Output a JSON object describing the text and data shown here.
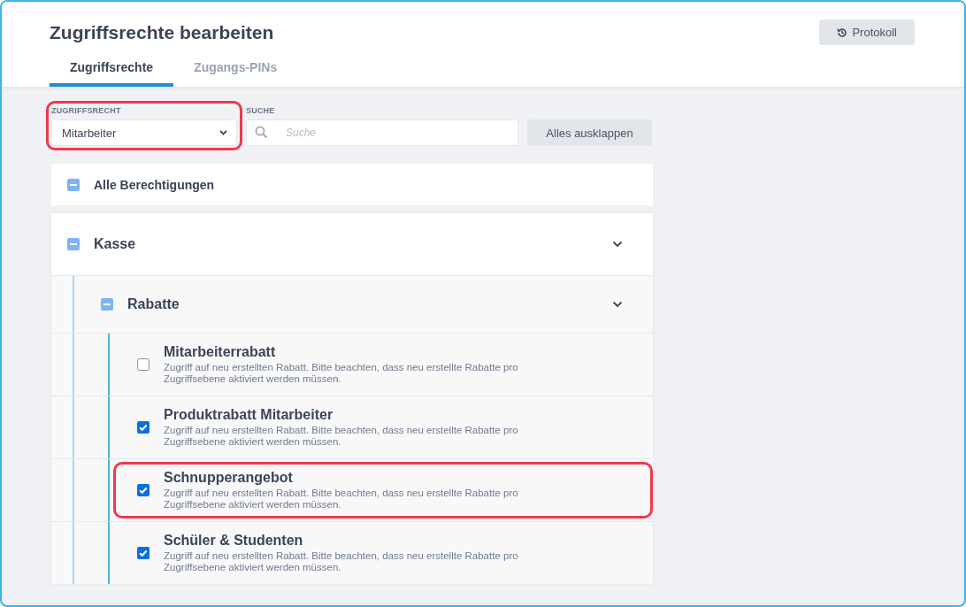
{
  "header": {
    "title": "Zugriffsrechte bearbeiten",
    "protocol_button": "Protokoll"
  },
  "tabs": [
    {
      "label": "Zugriffsrechte",
      "selected": true
    },
    {
      "label": "Zugangs-PINs",
      "selected": false
    }
  ],
  "filters": {
    "role": {
      "label": "ZUGRIFFSRECHT",
      "value": "Mitarbeiter",
      "highlighted": true
    },
    "search": {
      "label": "SUCHE",
      "placeholder": "Suche"
    },
    "expand_button": "Alles ausklappen"
  },
  "all_permissions": {
    "label": "Alle Berechtigungen",
    "partial": true
  },
  "tree": [
    {
      "label": "Kasse",
      "partial": true,
      "expanded": true,
      "children": [
        {
          "label": "Rabatte",
          "partial": true,
          "expanded": true,
          "children": [
            {
              "label": "Mitarbeiterrabatt",
              "description": "Zugriff auf neu erstellten Rabatt. Bitte beachten, dass neu erstellte Rabatte pro Zugriffsebene aktiviert werden müssen.",
              "checked": false,
              "highlighted": false
            },
            {
              "label": "Produktrabatt Mitarbeiter",
              "description": "Zugriff auf neu erstellten Rabatt. Bitte beachten, dass neu erstellte Rabatte pro Zugriffsebene aktiviert werden müssen.",
              "checked": true,
              "highlighted": false
            },
            {
              "label": "Schnupperangebot",
              "description": "Zugriff auf neu erstellten Rabatt. Bitte beachten, dass neu erstellte Rabatte pro Zugriffsebene aktiviert werden müssen.",
              "checked": true,
              "highlighted": true
            },
            {
              "label": "Schüler & Studenten",
              "description": "Zugriff auf neu erstellten Rabatt. Bitte beachten, dass neu erstellte Rabatte pro Zugriffsebene aktiviert werden müssen.",
              "checked": true,
              "highlighted": false
            }
          ]
        }
      ]
    }
  ]
}
